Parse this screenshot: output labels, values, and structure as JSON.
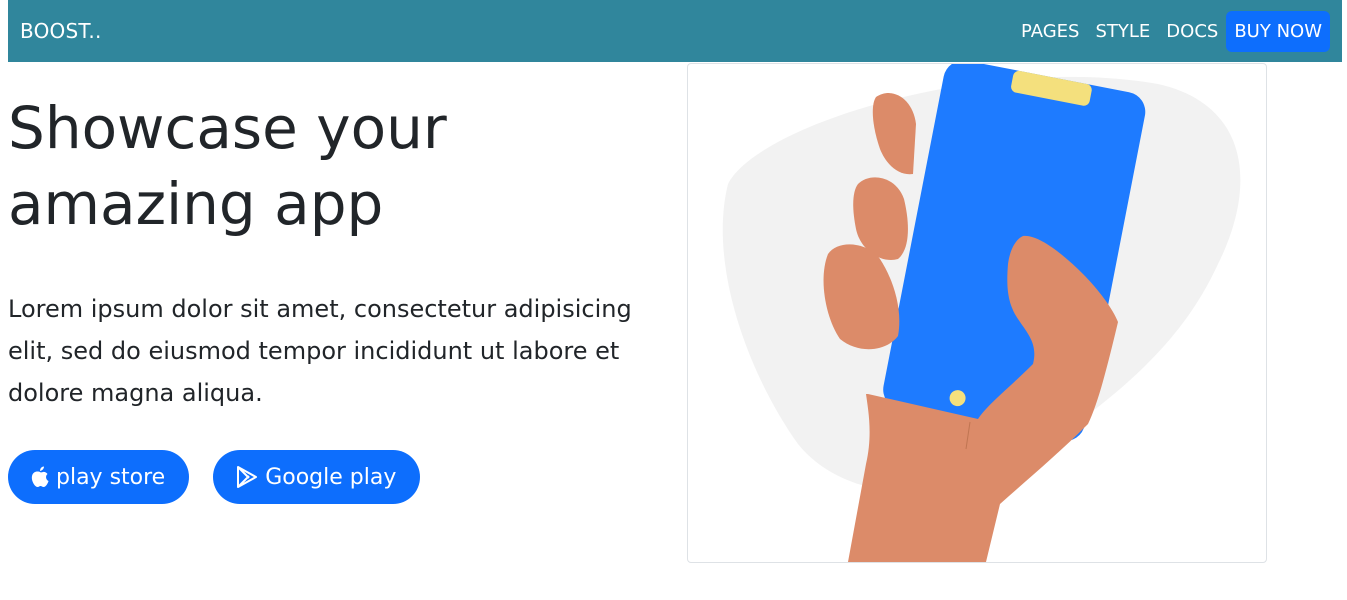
{
  "navbar": {
    "brand": "BOOST..",
    "links": [
      "PAGES",
      "STYLE",
      "DOCS"
    ],
    "buy_label": "BUY NOW",
    "bg_color": "#30869c"
  },
  "hero": {
    "title": "Showcase your\namazing app",
    "text": "Lorem ipsum dolor sit amet, consectetur adipisicing elit, sed do eiusmod tempor incididunt ut labore et dolore magna aliqua.",
    "buttons": [
      {
        "label": "play store",
        "icon": "apple-icon"
      },
      {
        "label": "Google play",
        "icon": "google-play-icon"
      }
    ],
    "accent_color": "#0d6efd"
  },
  "illustration": {
    "subject": "hand-holding-phone-illustration"
  }
}
